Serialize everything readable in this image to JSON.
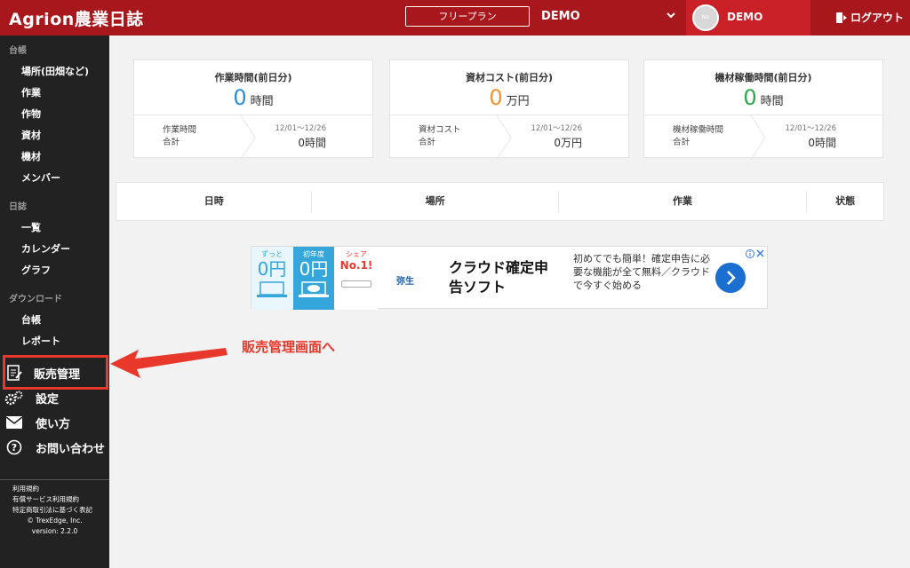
{
  "header": {
    "logo": "Agrion農業日誌",
    "plan": "フリープラン",
    "org": "DEMO",
    "avatar_text": "No Image",
    "user": "DEMO",
    "logout": "ログアウト"
  },
  "sidebar": {
    "sections": [
      {
        "heading": "台帳",
        "items": [
          "場所(田畑など)",
          "作業",
          "作物",
          "資材",
          "機材",
          "メンバー"
        ]
      },
      {
        "heading": "日誌",
        "items": [
          "一覧",
          "カレンダー",
          "グラフ"
        ]
      },
      {
        "heading": "ダウンロード",
        "items": [
          "台帳",
          "レポート"
        ]
      }
    ],
    "big_items": [
      {
        "label": "販売管理",
        "icon": "clipboard-icon"
      },
      {
        "label": "設定",
        "icon": "gears-icon"
      },
      {
        "label": "使い方",
        "icon": "envelope-icon"
      },
      {
        "label": "お問い合わせ",
        "icon": "question-icon"
      }
    ],
    "footer": {
      "terms": "利用規約",
      "paid_terms": "有償サービス利用規約",
      "commerce_law": "特定商取引法に基づく表記",
      "copyright": "© TrexEdge, Inc.",
      "version": "version: 2.2.0"
    }
  },
  "cards": [
    {
      "title": "作業時間(前日分)",
      "value": "0",
      "unit": "時間",
      "color": "#2a8fd6",
      "foot_label": "作業時間",
      "foot_sub": "合計",
      "period": "12/01〜12/26",
      "total": "0時間"
    },
    {
      "title": "資材コスト(前日分)",
      "value": "0",
      "unit": "万円",
      "color": "#f0922e",
      "foot_label": "資材コスト",
      "foot_sub": "合計",
      "period": "12/01〜12/26",
      "total": "0万円"
    },
    {
      "title": "機材稼働時間(前日分)",
      "value": "0",
      "unit": "時間",
      "color": "#2aa84a",
      "foot_label": "機材稼働時間",
      "foot_sub": "合計",
      "period": "12/01〜12/26",
      "total": "0時間"
    }
  ],
  "table": {
    "columns": [
      "日時",
      "場所",
      "作業",
      "状態"
    ]
  },
  "ad": {
    "panel1_top": "ずっと",
    "panel1_val": "0円",
    "panel2_top": "初年度",
    "panel2_val": "0円",
    "panel3_top": "シェア",
    "panel3_val": "No.1!",
    "brand": "弥生",
    "headline": "クラウド確定申告ソフト",
    "copy": "初めてでも簡単！確定申告に必要な機能が全て無料／クラウドで今すぐ始める"
  },
  "annotation": {
    "callout": "販売管理画面へ"
  }
}
